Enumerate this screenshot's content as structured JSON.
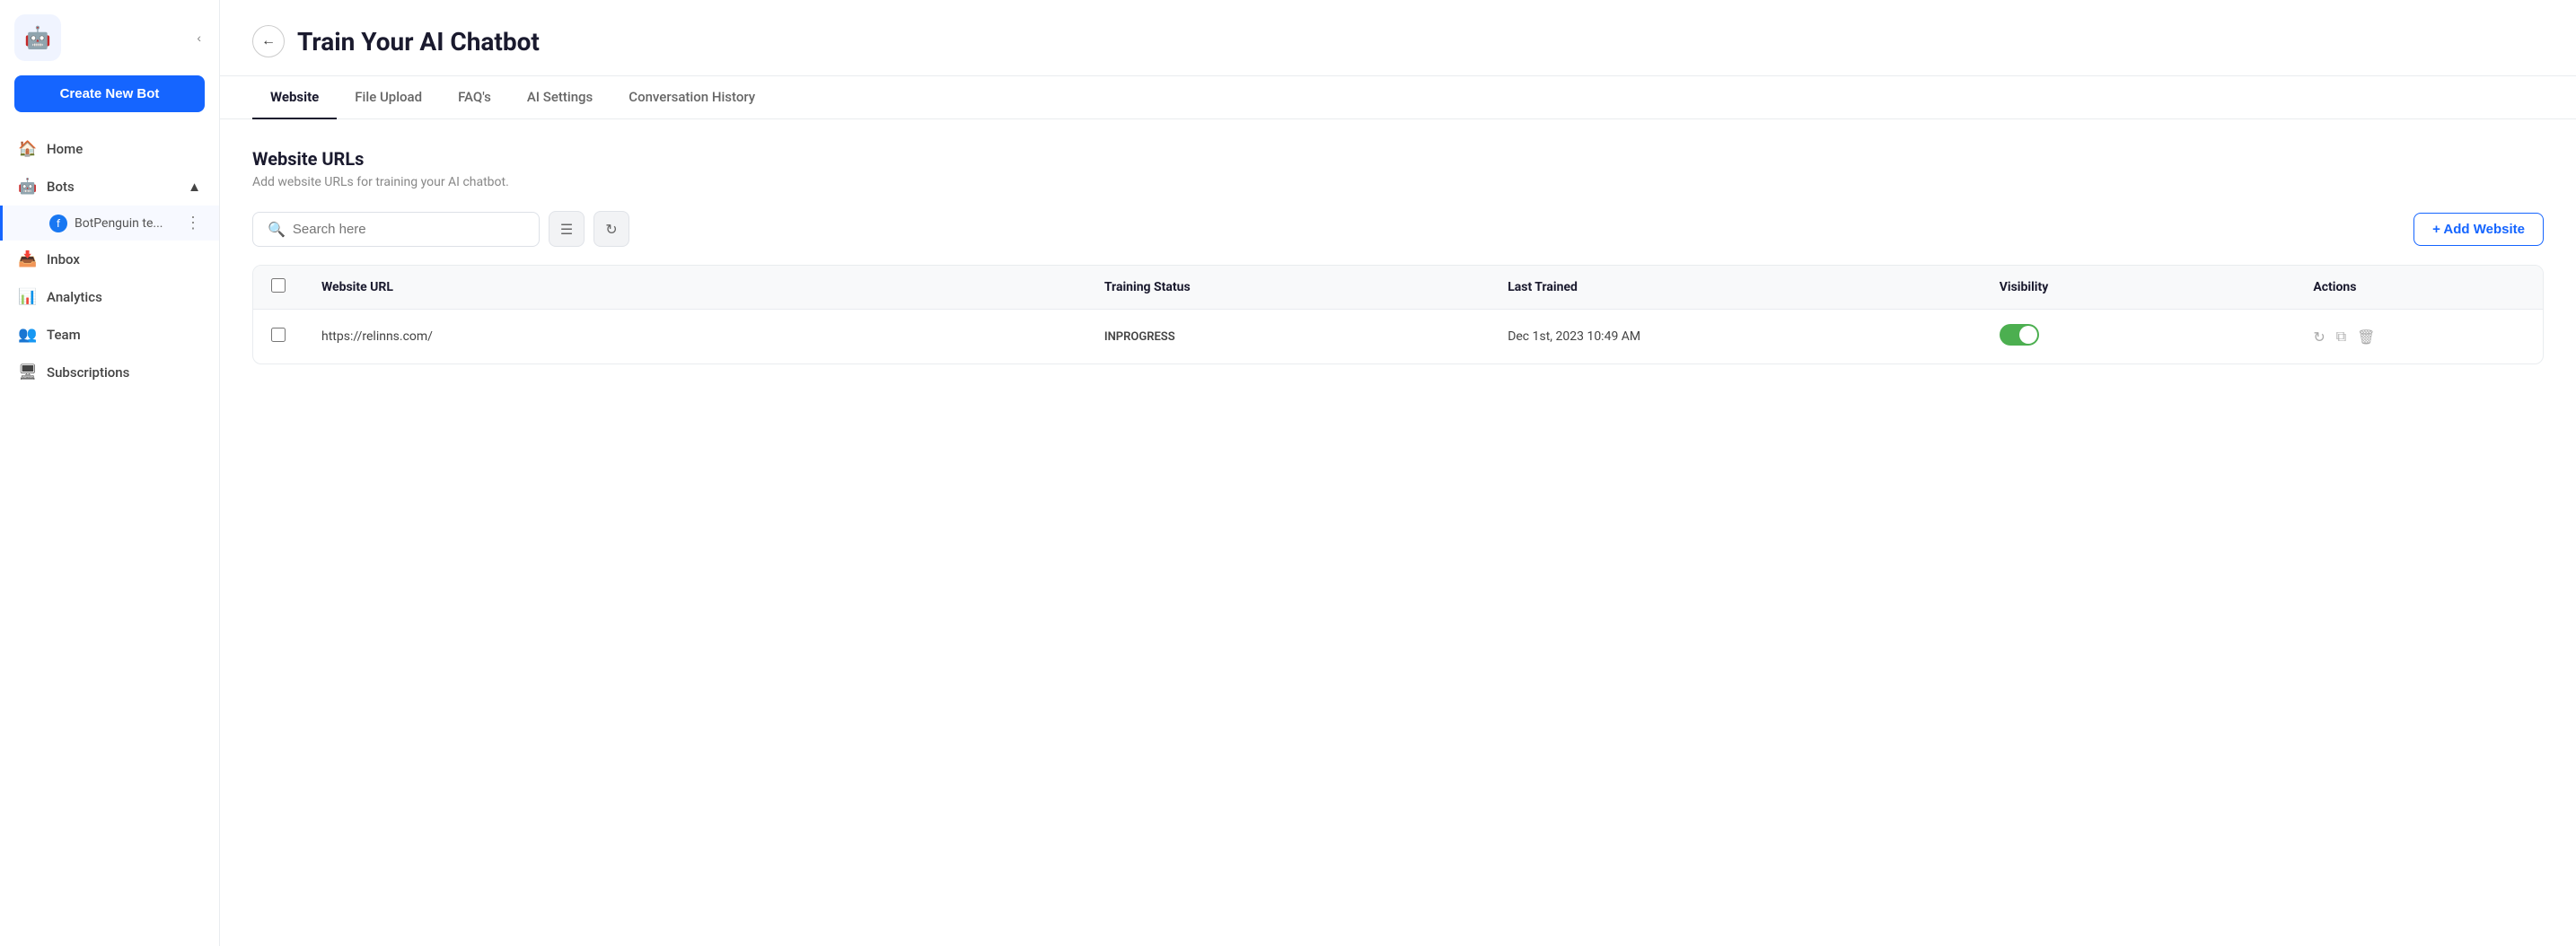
{
  "sidebar": {
    "logo_emoji": "🤖",
    "collapse_icon": "‹",
    "create_bot_label": "Create New Bot",
    "nav_items": [
      {
        "id": "home",
        "icon": "🏠",
        "label": "Home"
      },
      {
        "id": "bots",
        "icon": "🤖",
        "label": "Bots",
        "expandable": true,
        "expanded": true
      },
      {
        "id": "bot-subitem",
        "label": "BotPenguin te...",
        "icon": "📘"
      },
      {
        "id": "inbox",
        "icon": "📥",
        "label": "Inbox"
      },
      {
        "id": "analytics",
        "icon": "📊",
        "label": "Analytics"
      },
      {
        "id": "team",
        "icon": "👥",
        "label": "Team"
      },
      {
        "id": "subscriptions",
        "icon": "🖥",
        "label": "Subscriptions"
      }
    ]
  },
  "header": {
    "back_icon": "←",
    "title": "Train Your AI Chatbot"
  },
  "tabs": [
    {
      "id": "website",
      "label": "Website",
      "active": true
    },
    {
      "id": "file-upload",
      "label": "File Upload",
      "active": false
    },
    {
      "id": "faqs",
      "label": "FAQ's",
      "active": false
    },
    {
      "id": "ai-settings",
      "label": "AI Settings",
      "active": false
    },
    {
      "id": "conversation-history",
      "label": "Conversation History",
      "active": false
    }
  ],
  "section": {
    "title": "Website URLs",
    "description": "Add website URLs for training your AI chatbot."
  },
  "toolbar": {
    "search_placeholder": "Search here",
    "filter_icon": "☰",
    "refresh_icon": "↻",
    "add_website_label": "+ Add Website"
  },
  "table": {
    "columns": [
      {
        "id": "checkbox",
        "label": ""
      },
      {
        "id": "url",
        "label": "Website URL"
      },
      {
        "id": "status",
        "label": "Training Status"
      },
      {
        "id": "last_trained",
        "label": "Last Trained"
      },
      {
        "id": "visibility",
        "label": "Visibility"
      },
      {
        "id": "actions",
        "label": "Actions"
      }
    ],
    "rows": [
      {
        "url": "https://relinns.com/",
        "status": "INPROGRESS",
        "last_trained": "Dec 1st, 2023 10:49 AM",
        "visibility": true
      }
    ]
  }
}
